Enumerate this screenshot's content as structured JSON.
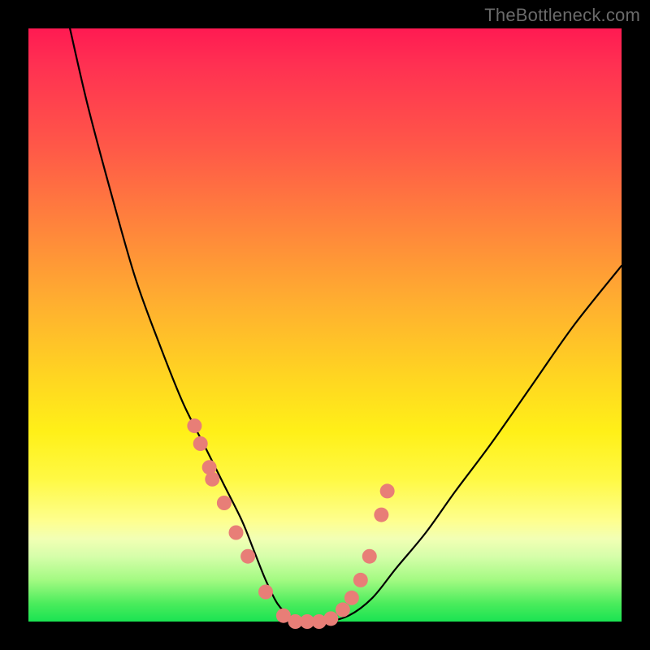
{
  "watermark": "TheBottleneck.com",
  "chart_data": {
    "type": "line",
    "title": "",
    "xlabel": "",
    "ylabel": "",
    "xlim": [
      0,
      100
    ],
    "ylim": [
      0,
      100
    ],
    "series": [
      {
        "name": "bottleneck-curve",
        "x": [
          7,
          10,
          14,
          18,
          22,
          26,
          30,
          33,
          36,
          38,
          40,
          42,
          44,
          46,
          50,
          54,
          58,
          62,
          67,
          72,
          78,
          85,
          92,
          100
        ],
        "y": [
          100,
          87,
          72,
          58,
          47,
          37,
          29,
          23,
          17,
          12,
          7,
          3,
          1,
          0,
          0,
          1,
          4,
          9,
          15,
          22,
          30,
          40,
          50,
          60
        ]
      }
    ],
    "marker_points": {
      "name": "highlight-dots",
      "x": [
        28,
        29,
        30.5,
        31,
        33,
        35,
        37,
        40,
        43,
        45,
        47,
        49,
        51,
        53,
        54.5,
        56,
        57.5,
        59.5,
        60.5
      ],
      "y": [
        33,
        30,
        26,
        24,
        20,
        15,
        11,
        5,
        1,
        0,
        0,
        0,
        0.5,
        2,
        4,
        7,
        11,
        18,
        22
      ]
    },
    "background_gradient": {
      "top": "#ff1a52",
      "mid": "#ffd322",
      "bottom": "#1ae352"
    }
  }
}
